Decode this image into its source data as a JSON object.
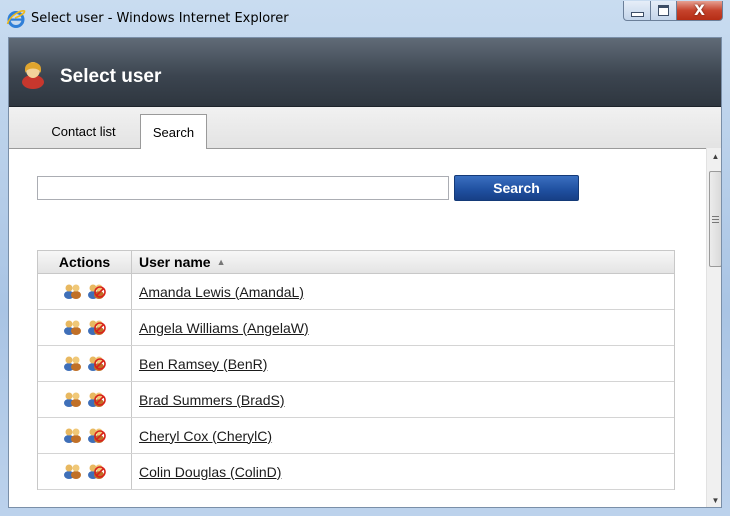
{
  "window": {
    "title": "Select user - Windows Internet Explorer",
    "close_glyph": "X"
  },
  "header": {
    "title": "Select user",
    "icon": "user-icon"
  },
  "tabs": [
    {
      "label": "Contact list",
      "active": false
    },
    {
      "label": "Search",
      "active": true
    }
  ],
  "search": {
    "value": "",
    "placeholder": "",
    "button_label": "Search"
  },
  "grid": {
    "columns": [
      "Actions",
      "User name"
    ],
    "sort_indicator": "▲",
    "rows": [
      {
        "name": "Amanda Lewis (AmandaL)"
      },
      {
        "name": "Angela Williams (AngelaW)"
      },
      {
        "name": "Ben Ramsey (BenR)"
      },
      {
        "name": "Brad Summers (BradS)"
      },
      {
        "name": "Cheryl Cox (CherylC)"
      },
      {
        "name": "Colin Douglas (ColinD)"
      }
    ],
    "row_action_icons": [
      "add-users-icon",
      "remove-users-icon"
    ]
  },
  "colors": {
    "header_bg": "#3c4550",
    "search_button": "#1f4f9f",
    "close_button": "#c6432c"
  }
}
